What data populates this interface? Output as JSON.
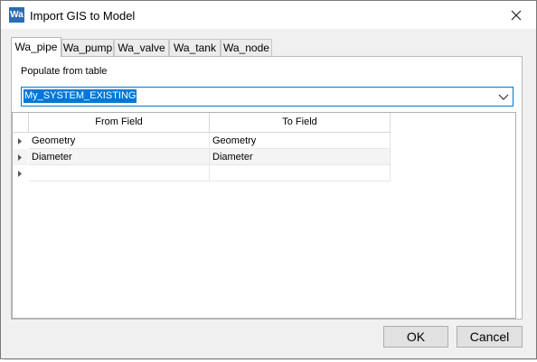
{
  "window": {
    "title": "Import GIS to Model",
    "icon_text": "Wa"
  },
  "tabs": [
    {
      "label": "Wa_pipe",
      "active": true
    },
    {
      "label": "Wa_pump",
      "active": false
    },
    {
      "label": "Wa_valve",
      "active": false
    },
    {
      "label": "Wa_tank",
      "active": false
    },
    {
      "label": "Wa_node",
      "active": false
    }
  ],
  "populate": {
    "label": "Populate from table",
    "selected": "My_SYSTEM_EXISTING"
  },
  "grid": {
    "columns": [
      "From Field",
      "To Field"
    ],
    "rows": [
      {
        "from": "Geometry",
        "to": "Geometry"
      },
      {
        "from": "Diameter",
        "to": "Diameter"
      },
      {
        "from": "",
        "to": ""
      }
    ]
  },
  "buttons": {
    "ok": "OK",
    "cancel": "Cancel"
  },
  "colors": {
    "accent": "#0078d7",
    "app_icon": "#2b6cb5"
  }
}
